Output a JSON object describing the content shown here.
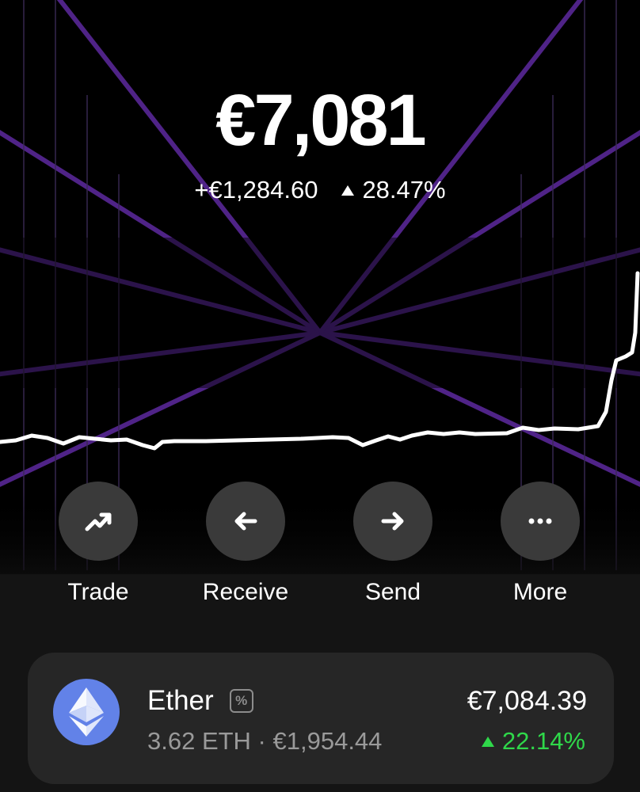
{
  "portfolio": {
    "balance": "€7,081",
    "change_amount": "+€1,284.60",
    "change_percent": "28.47%"
  },
  "actions": [
    {
      "label": "Trade",
      "icon": "trend-up-icon"
    },
    {
      "label": "Receive",
      "icon": "arrow-left-icon"
    },
    {
      "label": "Send",
      "icon": "arrow-right-icon"
    },
    {
      "label": "More",
      "icon": "more-dots-icon"
    }
  ],
  "asset": {
    "name": "Ether",
    "badge": "%",
    "holdings": "3.62 ETH · €1,954.44",
    "value": "€7,084.39",
    "change_percent": "22.14%",
    "icon": "ethereum-icon",
    "logo_color": "#6282e8",
    "positive_color": "#2fd84a"
  },
  "theme": {
    "background": "#000000",
    "accent": "#7b3fc4"
  }
}
